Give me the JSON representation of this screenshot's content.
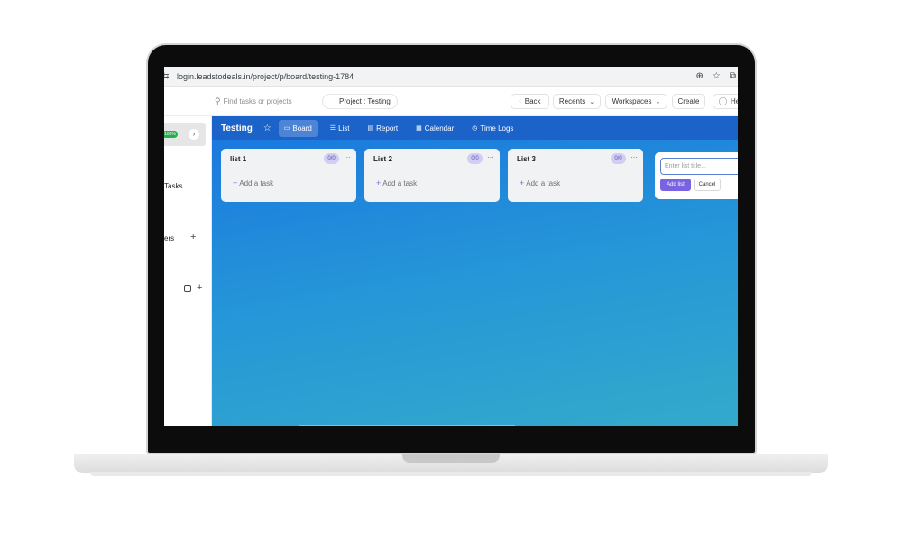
{
  "browser": {
    "url": "login.leadstodeals.in/project/p/board/testing-1784"
  },
  "topbar": {
    "search_placeholder": "Find tasks or projects",
    "project_label": "Project : Testing",
    "back_label": "Back",
    "recents_label": "Recents",
    "workspaces_label": "Workspaces",
    "create_label": "Create",
    "help_label": "He"
  },
  "sidebar": {
    "badge": "100%",
    "tasks_label": "Tasks",
    "members_label": "ers"
  },
  "board": {
    "title": "Testing",
    "tabs": [
      {
        "label": "Board",
        "icon": "board-icon"
      },
      {
        "label": "List",
        "icon": "list-icon"
      },
      {
        "label": "Report",
        "icon": "report-icon"
      },
      {
        "label": "Calendar",
        "icon": "calendar-icon"
      },
      {
        "label": "Time Logs",
        "icon": "clock-icon"
      }
    ],
    "lists": [
      {
        "title": "list 1",
        "count": "0/0",
        "add_task": "Add a task"
      },
      {
        "title": "List 2",
        "count": "0/0",
        "add_task": "Add a task"
      },
      {
        "title": "List 3",
        "count": "0/0",
        "add_task": "Add a task"
      }
    ],
    "new_list": {
      "placeholder": "Enter list title...",
      "add_label": "Add list",
      "cancel_label": "Cancel"
    }
  },
  "colors": {
    "board_header": "#1b62c9",
    "accent": "#7a63e3",
    "badge_green": "#22b04b"
  }
}
